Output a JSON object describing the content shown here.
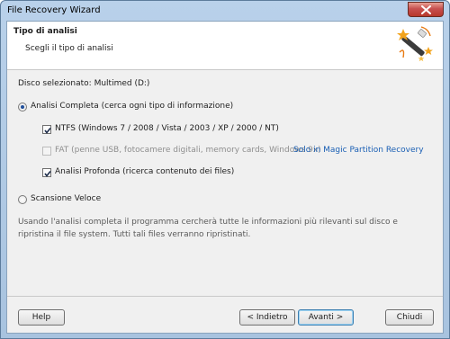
{
  "window": {
    "title": "File Recovery Wizard"
  },
  "header": {
    "title": "Tipo di analisi",
    "subtitle": "Scegli il tipo di analisi"
  },
  "content": {
    "selected_disk": "Disco selezionato: Multimed (D:)",
    "full_scan": {
      "label": "Analisi Completa (cerca ogni tipo di informazione)",
      "selected": true,
      "options": [
        {
          "label": "NTFS (Windows 7 / 2008 / Vista / 2003 / XP / 2000 / NT)",
          "checked": true,
          "enabled": true
        },
        {
          "label": "FAT (penne USB, fotocamere digitali, memory cards, Windows 9x)",
          "checked": false,
          "enabled": false,
          "link": "Solo in Magic Partition Recovery"
        },
        {
          "label": "Analisi Profonda (ricerca contenuto dei files)",
          "checked": true,
          "enabled": true
        }
      ]
    },
    "quick_scan": {
      "label": "Scansione Veloce",
      "selected": false
    },
    "info_text": "Usando l'analisi completa il programma cercherà tutte le informazioni più rilevanti sul disco e ripristina il file system. Tutti tali files verranno ripristinati."
  },
  "footer": {
    "help": "Help",
    "back": "< Indietro",
    "next": "Avanti >",
    "close": "Chiudi"
  },
  "colors": {
    "titlebar": "#b9d1ea",
    "close_button": "#c75050",
    "link": "#1a5fb4",
    "panel": "#f0f0f0"
  },
  "icons": {
    "close": "close-x-icon",
    "wizard": "magic-wand-icon",
    "check": "checkmark-icon"
  }
}
